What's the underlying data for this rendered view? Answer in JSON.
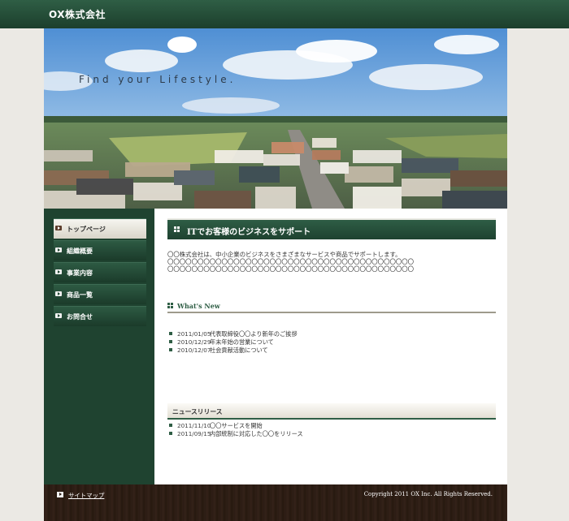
{
  "header": {
    "logo": "OX株式会社"
  },
  "hero": {
    "tagline": "Find your Lifestyle."
  },
  "sidebar": {
    "items": [
      {
        "label": "トップページ",
        "active": true
      },
      {
        "label": "組織概要",
        "active": false
      },
      {
        "label": "事業内容",
        "active": false
      },
      {
        "label": "商品一覧",
        "active": false
      },
      {
        "label": "お問合せ",
        "active": false
      }
    ]
  },
  "main": {
    "title": "ITでお客様のビジネスをサポート",
    "intro": [
      "〇〇株式会社は、中小企業のビジネスをさまざまなサービスや商品でサポートします。",
      "〇〇〇〇〇〇〇〇〇〇〇〇〇〇〇〇〇〇〇〇〇〇〇〇〇〇〇〇〇〇〇〇〇〇〇〇〇〇〇〇〇",
      "〇〇〇〇〇〇〇〇〇〇〇〇〇〇〇〇〇〇〇〇〇〇〇〇〇〇〇〇〇〇〇〇〇〇〇〇〇〇〇〇〇"
    ],
    "whats_new": {
      "title": "What's New",
      "items": [
        {
          "date": "2011/01/05",
          "text": "代表取締役〇〇より新年のご挨拶"
        },
        {
          "date": "2010/12/29",
          "text": "年末年始の営業について"
        },
        {
          "date": "2010/12/07",
          "text": "社会貢献活動について"
        }
      ]
    },
    "releases": {
      "title": "ニュースリリース",
      "items": [
        {
          "date": "2011/11/10",
          "text": "〇〇サービスを開始"
        },
        {
          "date": "2011/09/15",
          "text": "内部統制に対応した〇〇をリリース"
        }
      ]
    }
  },
  "footer": {
    "sitemap_label": "サイトマップ",
    "copyright": "Copyright 2011 OX Inc. All Rights Reserved."
  },
  "colors": {
    "brand_green": "#1f4330",
    "footer_brown": "#2b1c14"
  }
}
